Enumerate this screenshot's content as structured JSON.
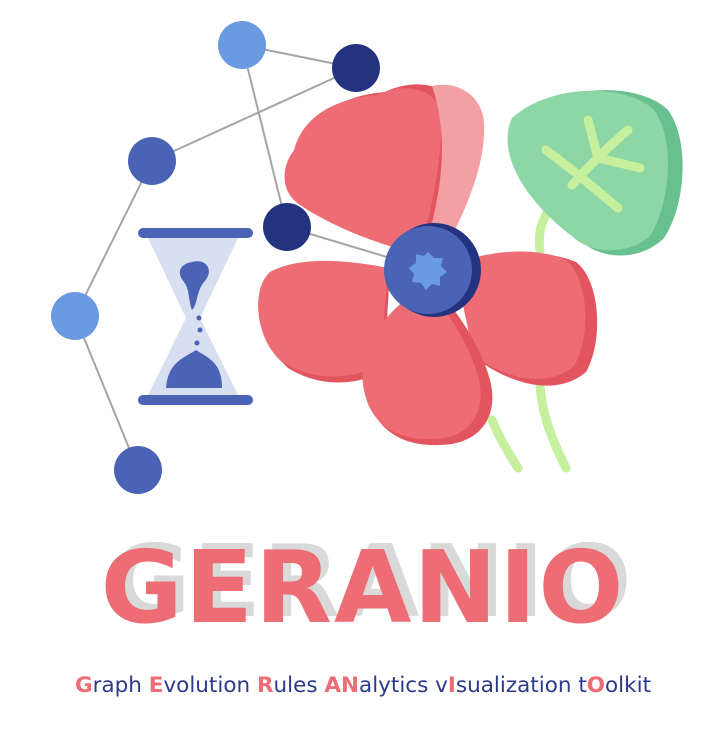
{
  "logo": {
    "title": "GERANIO",
    "subtitle_parts": [
      {
        "text": "G",
        "accent": true
      },
      {
        "text": "raph ",
        "accent": false
      },
      {
        "text": "E",
        "accent": true
      },
      {
        "text": "volution ",
        "accent": false
      },
      {
        "text": "R",
        "accent": true
      },
      {
        "text": "ules ",
        "accent": false
      },
      {
        "text": "AN",
        "accent": true
      },
      {
        "text": "alytics v",
        "accent": false
      },
      {
        "text": "I",
        "accent": true
      },
      {
        "text": "sualization t",
        "accent": false
      },
      {
        "text": "O",
        "accent": true
      },
      {
        "text": "olkit",
        "accent": false
      }
    ],
    "icons": [
      "graph-network-icon",
      "hourglass-icon",
      "geranium-flower-icon",
      "leaf-icon"
    ]
  },
  "colors": {
    "petal": "#ee6c74",
    "petal_dark": "#e3555e",
    "petal_light": "#f2a0a4",
    "node_blue": "#4a63b4",
    "node_navy": "#23337f",
    "node_light": "#6a9be0",
    "leaf": "#8dd6a6",
    "leaf_dark": "#69c08f",
    "vein": "#c6ef9e",
    "stem": "#c6ef9e",
    "edge": "#a5a5a5",
    "subtitle_text": "#2b3a8c",
    "title_shadow": "#d9d9d9"
  }
}
